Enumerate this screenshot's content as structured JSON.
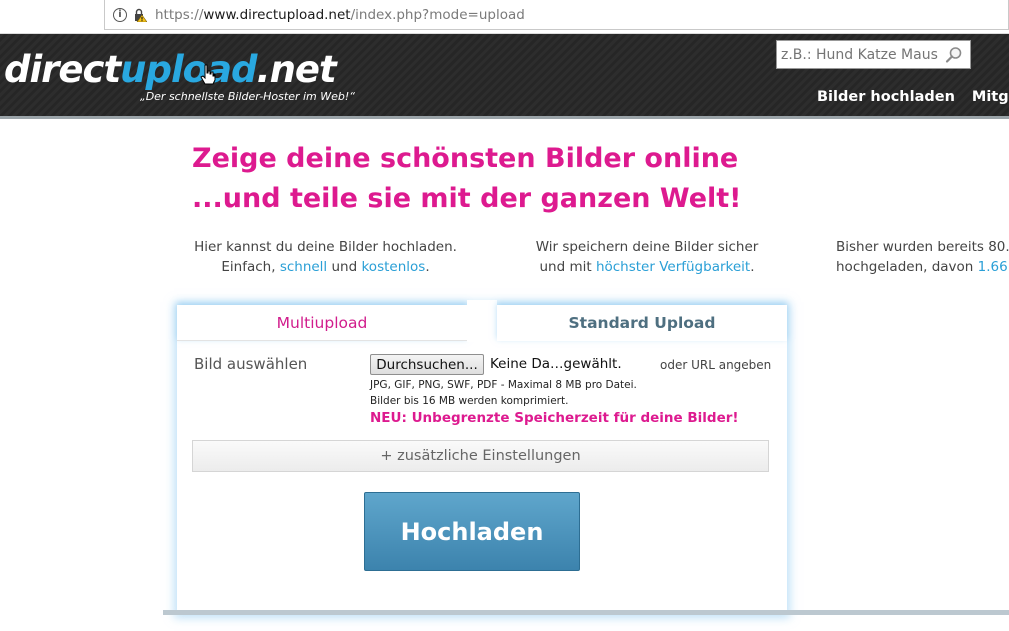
{
  "browser": {
    "url_scheme": "https://",
    "url_host": "www.directupload.net",
    "url_path": "/index.php?mode=upload",
    "icons": [
      "info-icon",
      "lock-warning-icon"
    ]
  },
  "header": {
    "logo_part1": "direct",
    "logo_part2": "upload",
    "logo_part3": ".net",
    "tagline": "„Der schnellste Bilder-Hoster im Web!“",
    "search_placeholder": "z.B.: Hund Katze Maus",
    "nav": [
      "Bilder hochladen",
      "Mitgliede"
    ],
    "accent_color": "#29a8e0"
  },
  "hero": {
    "line1": "Zeige deine schönsten Bilder online",
    "line2": "...und teile sie mit der ganzen Welt!",
    "color": "#dd1a8f"
  },
  "info": {
    "col1_line1": "Hier kannst du deine Bilder hochladen.",
    "col1_line2_a": "Einfach, ",
    "col1_link1": "schnell",
    "col1_line2_b": " und ",
    "col1_link2": "kostenlos",
    "col1_line2_c": ".",
    "col2_line1": "Wir speichern deine Bilder sicher",
    "col2_line2_a": "und mit ",
    "col2_link": "höchster Verfügbarkeit",
    "col2_line2_b": ".",
    "col3_line1_a": "Bisher wurden bereits ",
    "col3_line1_b": "80.",
    "col3_line2_a": "hochgeladen, davon ",
    "col3_line2_b": "1.66"
  },
  "upload": {
    "tab_multi": "Multiupload",
    "tab_standard": "Standard Upload",
    "label": "Bild auswählen",
    "browse_button": "Durchsuchen...",
    "no_file": "Keine Da…gewählt.",
    "url_option": "oder URL angeben",
    "hint1": "JPG, GIF, PNG, SWF, PDF - Maximal 8 MB pro Datei.",
    "hint2": "Bilder bis 16 MB werden komprimiert.",
    "new_note": "NEU: Unbegrenzte Speicherzeit für deine Bilder!",
    "extra_settings": "+ zusätzliche Einstellungen",
    "submit": "Hochladen"
  }
}
